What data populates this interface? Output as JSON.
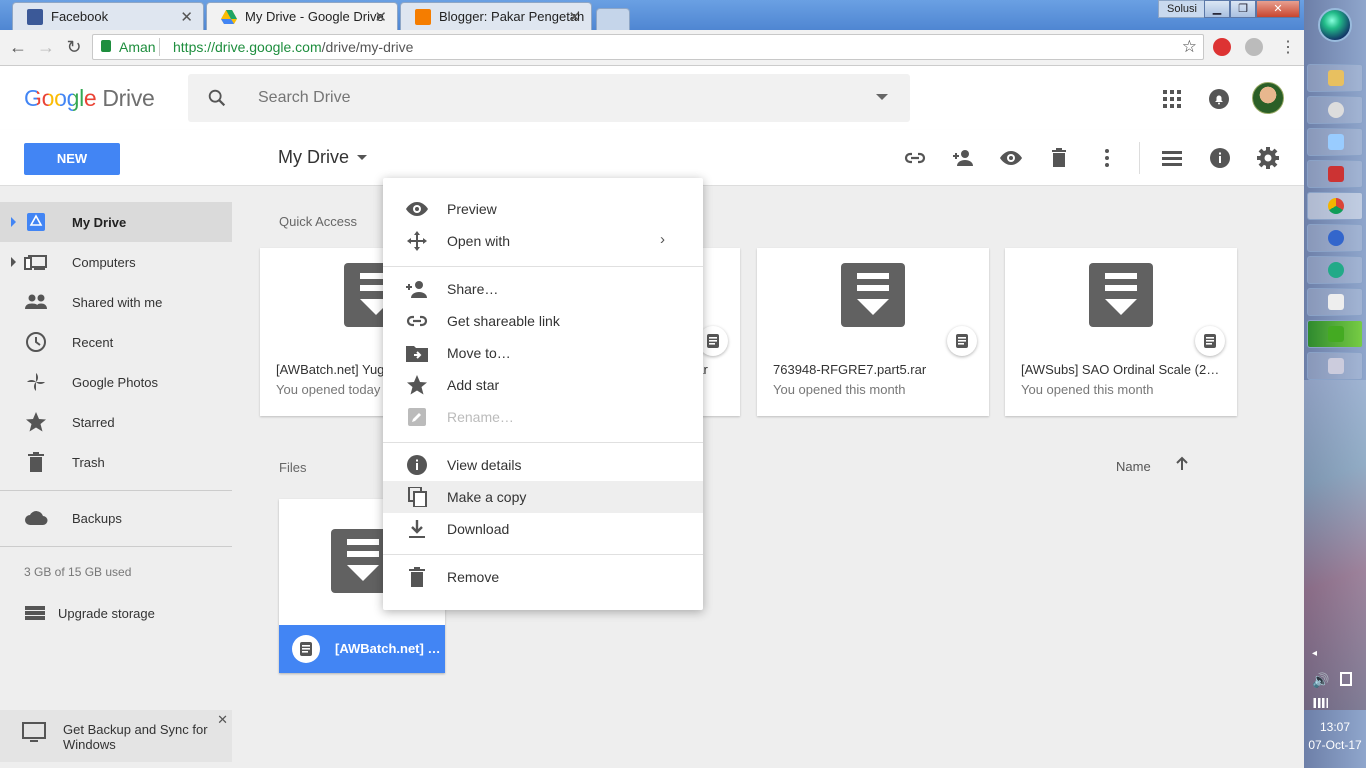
{
  "browser": {
    "tabs": [
      {
        "title": "Facebook",
        "active": false,
        "color": "#3b5998"
      },
      {
        "title": "My Drive - Google Drive",
        "active": true,
        "color": "#1fa463"
      },
      {
        "title": "Blogger: Pakar Pengetah",
        "active": false,
        "color": "#f57d00"
      }
    ],
    "window_label": "Solusi",
    "security_label": "Aman",
    "url_scheme_host": "https://drive.google.com",
    "url_path": "/drive/my-drive"
  },
  "drive": {
    "logo_google": "Google",
    "logo_drive": "Drive",
    "search_placeholder": "Search Drive",
    "new_button": "NEW",
    "breadcrumb": "My Drive",
    "sidebar": {
      "items": [
        {
          "label": "My Drive",
          "icon": "drive-icon",
          "selected": true,
          "expandable": true
        },
        {
          "label": "Computers",
          "icon": "computer-icon",
          "selected": false,
          "expandable": true
        },
        {
          "label": "Shared with me",
          "icon": "people-icon",
          "selected": false,
          "expandable": false
        },
        {
          "label": "Recent",
          "icon": "clock-icon",
          "selected": false,
          "expandable": false
        },
        {
          "label": "Google Photos",
          "icon": "pinwheel-icon",
          "selected": false,
          "expandable": false
        },
        {
          "label": "Starred",
          "icon": "star-icon",
          "selected": false,
          "expandable": false
        },
        {
          "label": "Trash",
          "icon": "trash-icon",
          "selected": false,
          "expandable": false
        }
      ],
      "backups": "Backups",
      "storage": "3 GB of 15 GB used",
      "upgrade": "Upgrade storage",
      "sync_promo": "Get Backup and Sync for Windows"
    },
    "quick_access_label": "Quick Access",
    "quick_access": [
      {
        "name": "[AWBatch.net] Yug",
        "sub": "You opened today"
      },
      {
        "name": "rar",
        "sub": ""
      },
      {
        "name": "763948-RFGRE7.part5.rar",
        "sub": "You opened this month"
      },
      {
        "name": "[AWSubs] SAO Ordinal Scale (201…",
        "sub": "You opened this month"
      }
    ],
    "files_label": "Files",
    "sort_label": "Name",
    "file": {
      "name": "[AWBatch.net] …"
    }
  },
  "context_menu": {
    "items": [
      {
        "label": "Preview",
        "icon": "eye-icon",
        "submenu": false,
        "disabled": false,
        "highlight": false
      },
      {
        "label": "Open with",
        "icon": "move-arrows-icon",
        "submenu": true,
        "disabled": false,
        "highlight": false
      },
      {
        "label": "Share…",
        "icon": "person-add-icon",
        "submenu": false,
        "disabled": false,
        "highlight": false
      },
      {
        "label": "Get shareable link",
        "icon": "link-icon",
        "submenu": false,
        "disabled": false,
        "highlight": false
      },
      {
        "label": "Move to…",
        "icon": "folder-move-icon",
        "submenu": false,
        "disabled": false,
        "highlight": false
      },
      {
        "label": "Add star",
        "icon": "star-icon",
        "submenu": false,
        "disabled": false,
        "highlight": false
      },
      {
        "label": "Rename…",
        "icon": "pencil-icon",
        "submenu": false,
        "disabled": true,
        "highlight": false
      },
      {
        "label": "View details",
        "icon": "info-icon",
        "submenu": false,
        "disabled": false,
        "highlight": false
      },
      {
        "label": "Make a copy",
        "icon": "copy-icon",
        "submenu": false,
        "disabled": false,
        "highlight": true
      },
      {
        "label": "Download",
        "icon": "download-icon",
        "submenu": false,
        "disabled": false,
        "highlight": false
      },
      {
        "label": "Remove",
        "icon": "trash-icon",
        "submenu": false,
        "disabled": false,
        "highlight": false
      }
    ]
  },
  "taskbar": {
    "time": "13:07",
    "date": "07-Oct-17"
  },
  "colors": {
    "google_blue": "#4285f4",
    "secure_green": "#1e8e3e",
    "icon_gray": "#616161"
  }
}
